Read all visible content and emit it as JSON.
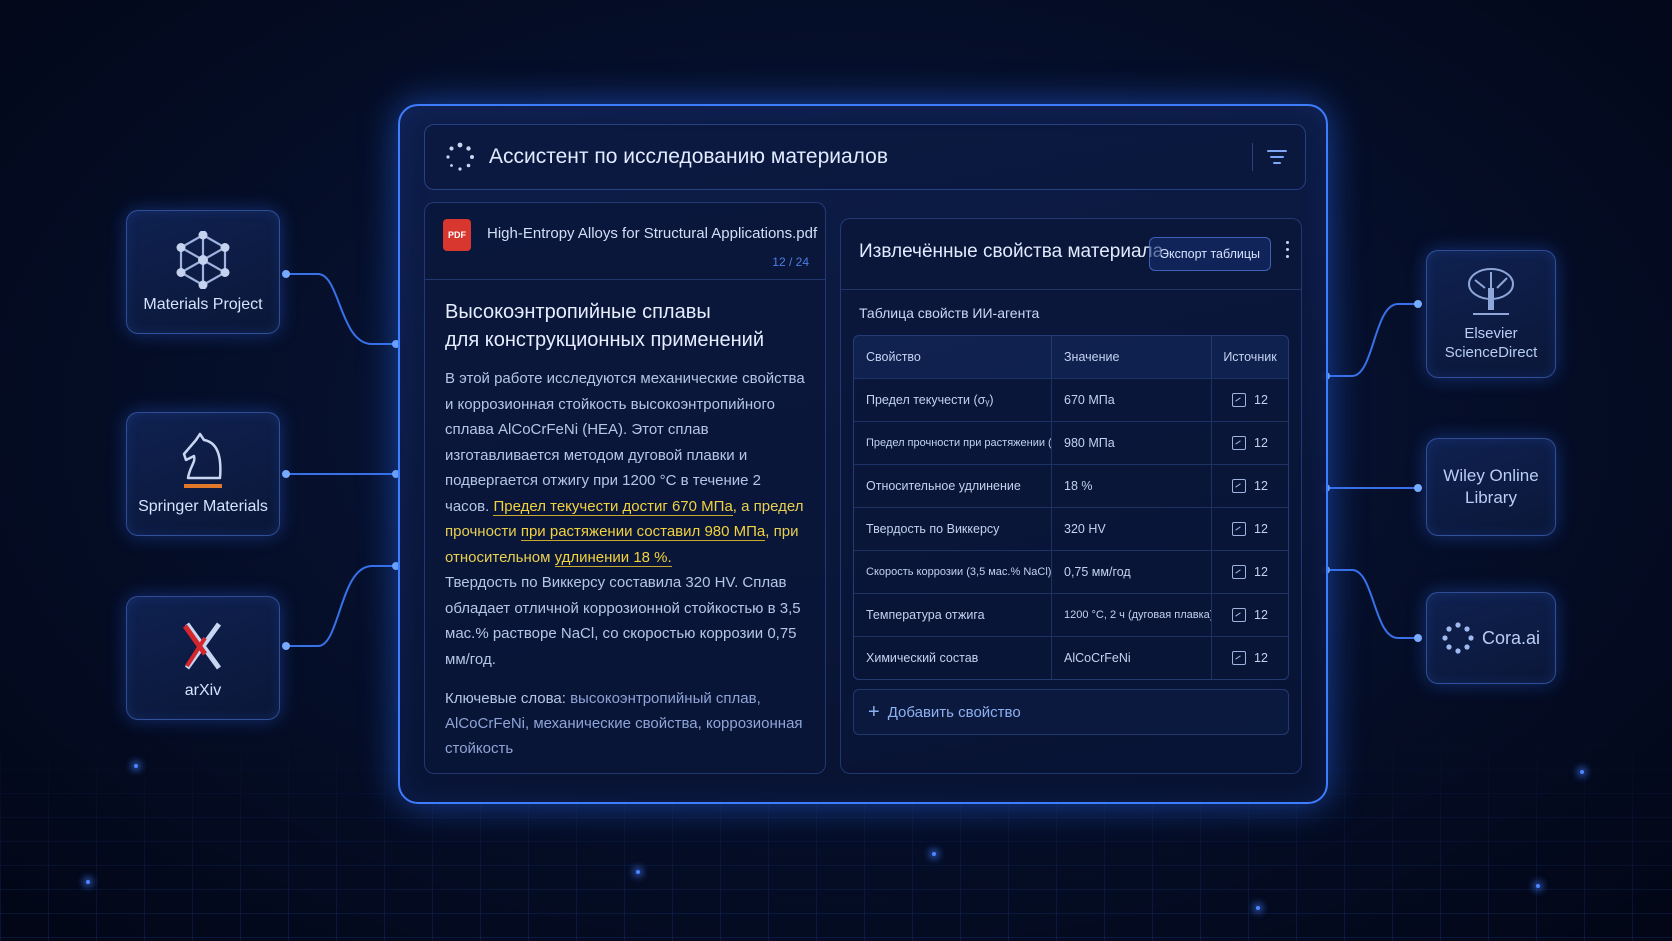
{
  "app": {
    "title": "Ассистент по исследованию материалов",
    "icons": {
      "logo": "loading-ring-icon",
      "filter": "filter-icon"
    }
  },
  "sources_left": [
    {
      "label": "Materials Project",
      "icon": "hexagon-network-icon"
    },
    {
      "label": "Springer Materials",
      "icon": "chess-knight-icon"
    },
    {
      "label": "arXiv",
      "icon": "arxiv-x-icon"
    }
  ],
  "sources_right": [
    {
      "label_line1": "Elsevier",
      "label_line2": "ScienceDirect",
      "icon": "tree-logo-icon"
    },
    {
      "label_line1": "Wiley Online",
      "label_line2": "Library"
    },
    {
      "label": "Cora.ai",
      "icon": "dotted-ring-icon"
    }
  ],
  "document": {
    "file_name": "High-Entropy Alloys for Structural Applications.pdf",
    "file_badge": "PDF",
    "page": "12 / 24",
    "title_line1": "Высокоэнтропийные сплавы",
    "title_line2": "для конструкционных применений",
    "intro": "В этой работе исследуются механические свойства и коррозионная стойкость высокоэнтропийного сплава AlCoCrFeNi (HEA). Этот сплав изготавливается методом дуговой плавки и подвергается отжигу при 1200 °C в течение 2 часов.",
    "hl1": "Предел текучести достиг 670 МПа",
    "mid1": ", а предел прочности ",
    "hl2": "при растяжении составил 980 МПа",
    "mid2": ", при относительном ",
    "hl3": "удлинении 18 %.",
    "rest": "Твердость по Виккерсу составила 320 HV. Сплав обладает отличной коррозионной стойкостью в 3,5 мас.% растворе NaCl, со скоростью коррозии 0,75 мм/год.",
    "keywords_label": "Ключевые слова: ",
    "keywords": "высокоэнтропийный сплав, AlCoCrFeNi, механические свойства, коррозионная стойкость",
    "highlight_color": "#f2d23e"
  },
  "properties": {
    "title": "Извлечённые свойства материала",
    "export_label": "Экспорт таблицы",
    "caption": "Таблица свойств ИИ-агента",
    "columns": [
      "Свойство",
      "Значение",
      "Источник"
    ],
    "rows": [
      {
        "name": "Предел текучести (σᵧ)",
        "value": "670 МПа",
        "source": "12"
      },
      {
        "name": "Предел прочности при растяжении (σᵤ)",
        "value": "980 МПа",
        "source": "12"
      },
      {
        "name": "Относительное удлинение",
        "value": "18 %",
        "source": "12"
      },
      {
        "name": "Твердость по Виккерсу",
        "value": "320 HV",
        "source": "12"
      },
      {
        "name": "Скорость коррозии (3,5 мас.% NaCl)",
        "value": "0,75 мм/год",
        "source": "12"
      },
      {
        "name": "Температура отжига",
        "value": "1200 °C, 2 ч (дуговая плавка)",
        "source": "12"
      },
      {
        "name": "Химический состав",
        "value": "AlCoCrFeNi",
        "source": "12"
      }
    ],
    "add_label": "Добавить свойство"
  },
  "colors": {
    "accent": "#3f7dff",
    "background": "#06102c",
    "pdf": "#d8372f"
  }
}
